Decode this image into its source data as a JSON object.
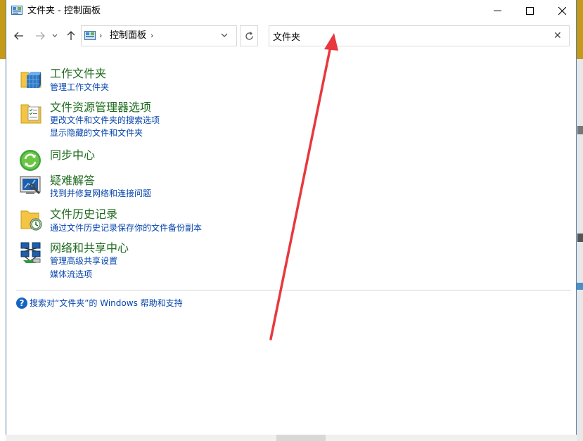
{
  "window": {
    "title": "文件夹 - 控制面板"
  },
  "navigation": {
    "back_icon": "back-arrow-icon",
    "forward_icon": "forward-arrow-icon",
    "recent_icon": "chevron-down-icon",
    "up_icon": "up-arrow-icon",
    "breadcrumb": [
      "控制面板"
    ],
    "refresh_icon": "refresh-icon"
  },
  "search": {
    "value": "文件夹",
    "clear_icon": "close-icon"
  },
  "results": [
    {
      "title": "工作文件夹",
      "icon": "work-folders-icon",
      "links": [
        "管理工作文件夹"
      ]
    },
    {
      "title": "文件资源管理器选项",
      "icon": "explorer-options-icon",
      "links": [
        "更改文件和文件夹的搜索选项",
        "显示隐藏的文件和文件夹"
      ]
    },
    {
      "title": "同步中心",
      "icon": "sync-center-icon",
      "links": []
    },
    {
      "title": "疑难解答",
      "icon": "troubleshooting-icon",
      "links": [
        "找到并修复网络和连接问题"
      ]
    },
    {
      "title": "文件历史记录",
      "icon": "file-history-icon",
      "links": [
        "通过文件历史记录保存你的文件备份副本"
      ]
    },
    {
      "title": "网络和共享中心",
      "icon": "network-sharing-icon",
      "links": [
        "管理高级共享设置",
        "媒体流选项"
      ]
    }
  ],
  "help": {
    "text": "搜索对“文件夹”的 Windows 帮助和支持",
    "icon": "help-icon"
  },
  "annotation": {
    "color": "#e8383d"
  },
  "colors": {
    "title_green": "#1e6b1e",
    "link_blue": "#0645ad",
    "desktop_gold": "#c59a18"
  }
}
